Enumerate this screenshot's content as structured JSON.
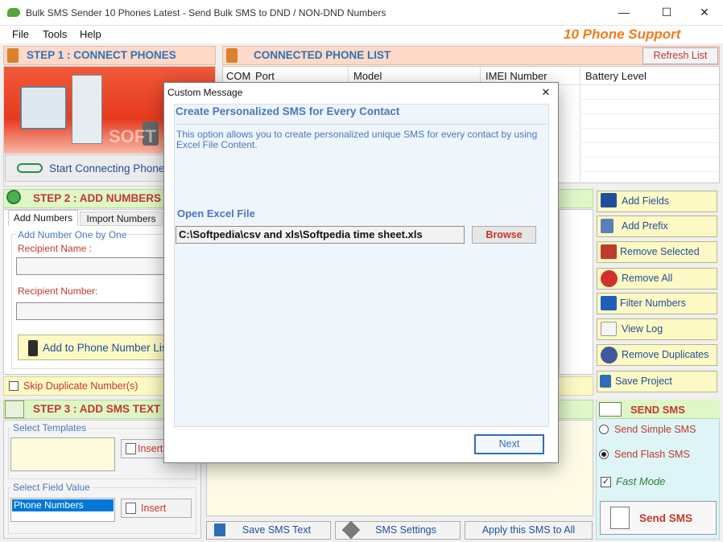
{
  "window": {
    "title": "Bulk SMS Sender 10 Phones Latest - Send Bulk SMS to DND / NON-DND Numbers",
    "minimize": "—",
    "maximize": "☐",
    "close": "✕"
  },
  "menu": {
    "file": "File",
    "tools": "Tools",
    "help": "Help",
    "support": "10 Phone Support"
  },
  "step1": {
    "title": "STEP 1 : CONNECT PHONES",
    "start_button": "Start Connecting Phones",
    "watermark": "SOFT"
  },
  "phone_list": {
    "title": "CONNECTED PHONE LIST",
    "refresh": "Refresh List",
    "columns": {
      "com": "COM",
      "port": "Port",
      "model": "Model",
      "imei": "IMEI Number",
      "battery": "Battery Level"
    }
  },
  "step2": {
    "title": "STEP 2 : ADD NUMBERS",
    "tab_add": "Add Numbers",
    "tab_import": "Import Numbers",
    "group_label": "Add Number One by One",
    "recipient_name_label": "Recipient Name :",
    "recipient_number_label": "Recipient Number:",
    "add_button": "Add to Phone Number List",
    "skip_duplicate": "Skip Duplicate Number(s)"
  },
  "side_buttons": {
    "add_fields": "Add Fields",
    "add_prefix": "Add Prefix",
    "remove_selected": "Remove Selected",
    "remove_all": "Remove All",
    "filter_numbers": "Filter Numbers",
    "view_log": "View Log",
    "remove_duplicates": "Remove Duplicates",
    "save_project": "Save Project"
  },
  "step3": {
    "title": "STEP 3 : ADD SMS TEXT",
    "templates_label": "Select Templates",
    "insert1": "Insert",
    "field_value_label": "Select Field Value",
    "field_value_selected": "Phone Numbers",
    "insert2": "Insert"
  },
  "bottom_buttons": {
    "save_sms": "Save SMS Text",
    "sms_settings": "SMS Settings",
    "apply_sms": "Apply this SMS to All"
  },
  "send": {
    "title": "SEND SMS",
    "simple": "Send Simple SMS",
    "flash": "Send Flash SMS",
    "fast_mode": "Fast Mode",
    "send_button": "Send SMS"
  },
  "dialog": {
    "title": "Custom Message",
    "close": "✕",
    "heading": "Create Personalized SMS for Every Contact",
    "description": "This option allows you to create personalized unique SMS for every contact by using Excel File Content.",
    "open_label": "Open Excel File",
    "file_path": "C:\\Softpedia\\csv and xls\\Softpedia time sheet.xls",
    "browse": "Browse",
    "next": "Next"
  },
  "colors": {
    "accent_orange": "#f07c1e",
    "step_blue": "#2e74b5",
    "step_red": "#c0392b"
  }
}
